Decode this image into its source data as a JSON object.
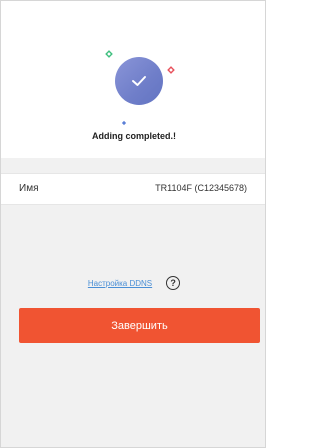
{
  "status": {
    "title": "Adding completed.!"
  },
  "device": {
    "name_label": "Имя",
    "name_value": "TR1104F (C12345678)"
  },
  "ddns": {
    "link_label": "Настройка DDNS",
    "help_glyph": "?"
  },
  "actions": {
    "finish_label": "Завершить"
  },
  "icons": {
    "success": "checkmark-icon",
    "sparkles": [
      "sparkle-green-icon",
      "sparkle-red-icon",
      "sparkle-blue-icon"
    ],
    "help": "help-icon"
  },
  "colors": {
    "accent": "#f05432",
    "link": "#4a8fd6",
    "success_circle": "#6f7ec9",
    "sparkle_green": "#3fbf7f",
    "sparkle_red": "#e8505b",
    "sparkle_blue": "#5b7fd6"
  }
}
